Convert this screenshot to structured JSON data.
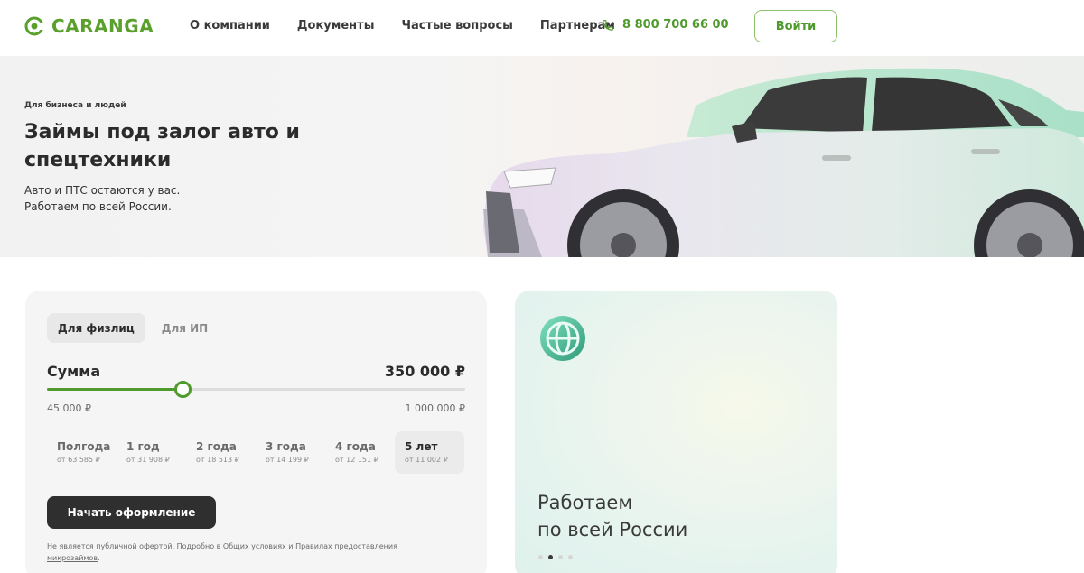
{
  "header": {
    "logo_text": "CARANGA",
    "nav": [
      "О компании",
      "Документы",
      "Частые вопросы",
      "Партнерам"
    ],
    "phone": "8 800 700 66 00",
    "login_label": "Войти",
    "accent_color": "#5aa02c"
  },
  "hero": {
    "tag": "Для бизнеса и людей",
    "title": "Займы под залог авто и спецтехники",
    "subtitle_line1": "Авто и ПТС остаются у вас.",
    "subtitle_line2": "Работаем по всей России."
  },
  "calculator": {
    "tabs": [
      {
        "label": "Для физлиц",
        "active": true
      },
      {
        "label": "Для ИП",
        "active": false
      }
    ],
    "sum_label": "Сумма",
    "sum_value": "350 000 ₽",
    "range_min": "45 000 ₽",
    "range_max": "1 000 000 ₽",
    "slider_fraction": 0.325,
    "terms": [
      {
        "name": "Полгода",
        "price": "от 63 585 ₽",
        "active": false
      },
      {
        "name": "1 год",
        "price": "от 31 908 ₽",
        "active": false
      },
      {
        "name": "2 года",
        "price": "от 18 513 ₽",
        "active": false
      },
      {
        "name": "3 года",
        "price": "от 14 199 ₽",
        "active": false
      },
      {
        "name": "4 года",
        "price": "от 12 151 ₽",
        "active": false
      },
      {
        "name": "5 лет",
        "price": "от 11 002 ₽",
        "active": true
      }
    ],
    "start_label": "Начать оформление",
    "disclaimer_prefix": "Не является публичной офертой. Подробно в ",
    "disclaimer_link1": "Общих условиях",
    "disclaimer_mid": " и ",
    "disclaimer_link2": "Правилах предоставления микрозаймов",
    "disclaimer_suffix": "."
  },
  "promo": {
    "title_line1": "Работаем",
    "title_line2": "по всей России",
    "icon": "globe-icon",
    "dots_count": 4,
    "active_dot": 1
  }
}
